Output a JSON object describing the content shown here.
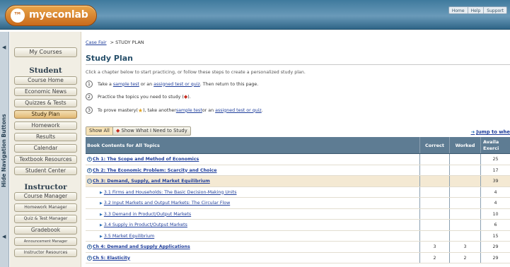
{
  "header": {
    "logo_badge": "™",
    "logo_text": "myeconlab",
    "links": [
      "Home",
      "Help",
      "Support"
    ]
  },
  "navrail": {
    "label": "Hide Navigation Buttons",
    "arrow_top": "◀",
    "arrow_bottom": "◀"
  },
  "sidebar": {
    "my_courses": "My Courses",
    "student_heading": "Student",
    "student_items": [
      "Course Home",
      "Economic News",
      "Quizzes & Tests",
      "Study Plan",
      "Homework",
      "Results",
      "Calendar",
      "Textbook Resources",
      "Student Center"
    ],
    "instructor_heading": "Instructor",
    "instructor_items": [
      "Course Manager",
      "Homework Manager",
      "Quiz & Test Manager",
      "Gradebook",
      "Announcement Manager",
      "Instructor Resources"
    ]
  },
  "breadcrumb": {
    "link": "Case Fair",
    "current": "> STUDY PLAN"
  },
  "page_title": "Study Plan",
  "intro": "Click a chapter below to start practicing, or follow these steps to create a personalized study plan.",
  "steps": {
    "s1": {
      "num": "1",
      "a": "Take a ",
      "link1": "sample test",
      "b": " or an ",
      "link2": "assigned test or quiz",
      "c": ". Then return to this page."
    },
    "s2": {
      "num": "2",
      "a": "Practice the topics you need to study (",
      "b": ")."
    },
    "s3": {
      "num": "3",
      "a": "To prove mastery(",
      "b": "), take another ",
      "link1": "sample test",
      "c": " or an ",
      "link2": "assigned test or quiz",
      "d": "."
    }
  },
  "show_bar": {
    "all": "Show All",
    "need": "Show What I Need to Study"
  },
  "jump_link": "Jump to whe",
  "table": {
    "headers": {
      "title": "Book Contents for All Topics",
      "correct": "Correct",
      "worked": "Worked",
      "avail1": "Availa",
      "avail2": "Exerci"
    },
    "rows": [
      {
        "kind": "chapter",
        "title": "Ch 1: The Scope and Method of Economics",
        "correct": "",
        "worked": "",
        "available": "25"
      },
      {
        "kind": "chapter",
        "title": "Ch 2: The Economic Problem: Scarcity and Choice",
        "correct": "",
        "worked": "",
        "available": "17"
      },
      {
        "kind": "chapter-open",
        "title": "Ch 3: Demand, Supply, and Market Equilibrium",
        "correct": "",
        "worked": "",
        "available": "39"
      },
      {
        "kind": "section",
        "title": "3.1 Firms and Households: The Basic Decision-Making Units",
        "correct": "",
        "worked": "",
        "available": "4"
      },
      {
        "kind": "section",
        "title": "3.2 Input Markets and Output Markets: The Circular Flow",
        "correct": "",
        "worked": "",
        "available": "4"
      },
      {
        "kind": "section",
        "title": "3.3 Demand in Product/Output Markets",
        "correct": "",
        "worked": "",
        "available": "10"
      },
      {
        "kind": "section",
        "title": "3.4 Supply in Product/Output Markets",
        "correct": "",
        "worked": "",
        "available": "6"
      },
      {
        "kind": "section",
        "title": "3.5 Market Equilibrium",
        "correct": "",
        "worked": "",
        "available": "15"
      },
      {
        "kind": "chapter",
        "title": "Ch 4: Demand and Supply Applications",
        "correct": "3",
        "worked": "3",
        "available": "29"
      },
      {
        "kind": "chapter",
        "title": "Ch 5: Elasticity",
        "correct": "2",
        "worked": "2",
        "available": "29"
      }
    ]
  },
  "colors": {
    "header_blue": "#4a82a6",
    "logo_orange": "#d98a2f",
    "table_header": "#5e7c93",
    "open_row": "#f4e9d3",
    "link": "#1f3e9b",
    "need_diamond": "#c62b1e",
    "mastery_star": "#e3a21b"
  }
}
